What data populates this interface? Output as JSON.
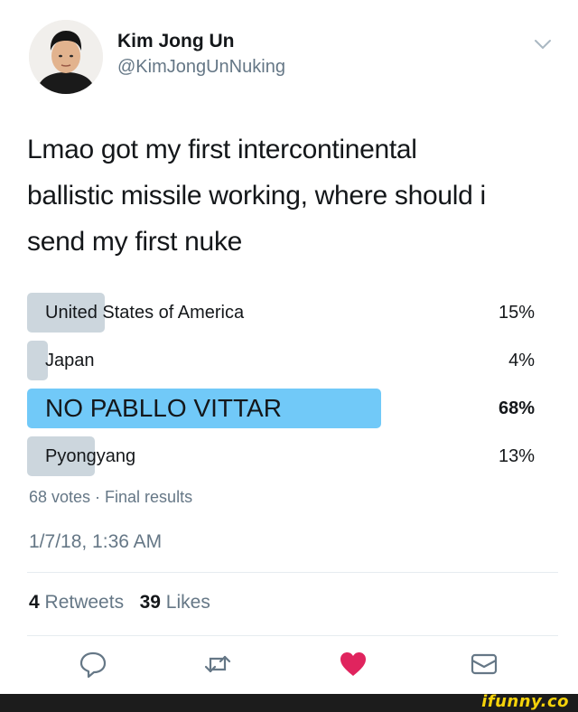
{
  "user": {
    "name": "Kim Jong Un",
    "handle": "@KimJongUnNuking"
  },
  "tweet": {
    "line1": "Lmao got my first intercontinental",
    "line2": "ballistic missile working, where should i",
    "line3": "send my first nuke"
  },
  "poll": {
    "options": [
      {
        "label": "United States of America",
        "percent_text": "15%",
        "percent": 15
      },
      {
        "label": "Japan",
        "percent_text": "4%",
        "percent": 4
      },
      {
        "label": "NO PABLLO VITTAR",
        "percent_text": "68%",
        "percent": 68,
        "winner": true
      },
      {
        "label": "Pyongyang",
        "percent_text": "13%",
        "percent": 13
      }
    ],
    "meta": "68 votes · Final results"
  },
  "timestamp": "1/7/18, 1:36 AM",
  "stats": {
    "retweets_count": "4",
    "retweets_label": "Retweets",
    "likes_count": "39",
    "likes_label": "Likes"
  },
  "icons": {
    "reply": "reply-icon",
    "retweet": "retweet-icon",
    "like": "heart-icon",
    "dm": "envelope-icon",
    "caret": "chevron-down-icon"
  },
  "colors": {
    "winner_bar": "#71c9f8",
    "bar": "#ccd6dd",
    "heart": "#e0245e",
    "muted": "#657786",
    "watermark": "#f5d20a"
  },
  "watermark": "ifunny.co"
}
